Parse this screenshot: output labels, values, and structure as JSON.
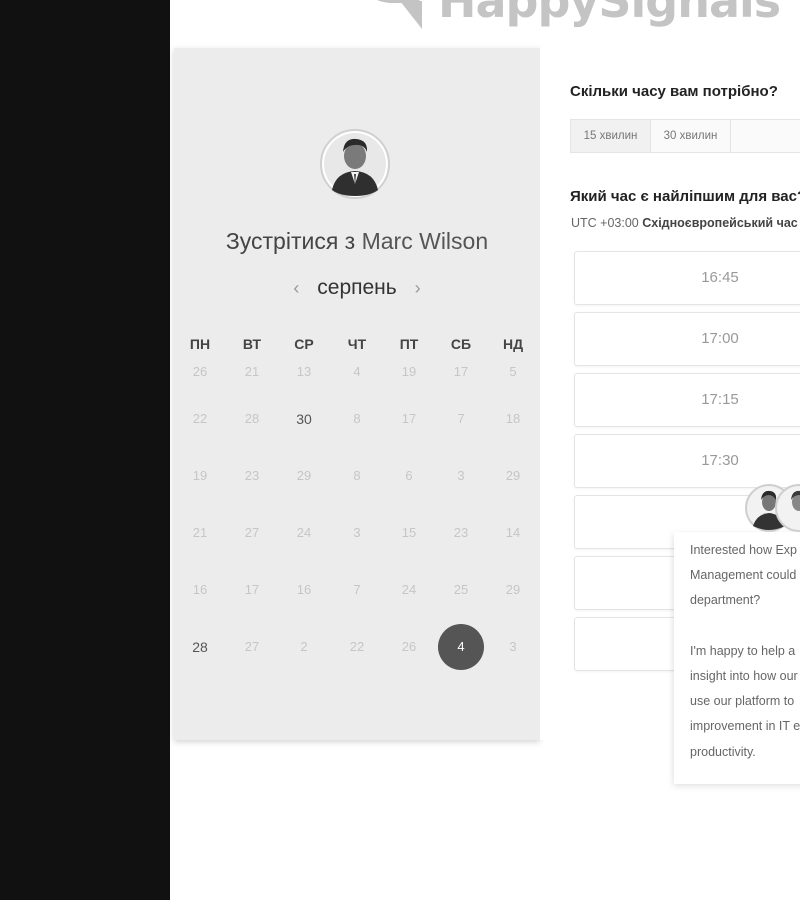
{
  "brand": {
    "name": "HappySignals"
  },
  "card": {
    "title_prefix": "Зустрітися з ",
    "host_name": "Marc Wilson",
    "month": "серпень",
    "prev_icon": "chevron-left-icon",
    "next_icon": "chevron-right-icon"
  },
  "calendar": {
    "weekdays": [
      "ПН",
      "ВТ",
      "СР",
      "ЧТ",
      "ПТ",
      "СБ",
      "НД"
    ],
    "weeks": [
      [
        "26",
        "21",
        "13",
        "4",
        "19",
        "17",
        "5"
      ],
      [
        "22",
        "28",
        "30",
        "8",
        "17",
        "7",
        "18"
      ],
      [
        "19",
        "23",
        "29",
        "8",
        "6",
        "3",
        "29"
      ],
      [
        "21",
        "27",
        "24",
        "3",
        "15",
        "23",
        "14"
      ],
      [
        "16",
        "17",
        "16",
        "7",
        "24",
        "25",
        "29"
      ],
      [
        "28",
        "27",
        "2",
        "22",
        "26",
        "4",
        "3"
      ]
    ],
    "available": [
      "1-2",
      "5-0"
    ],
    "selected": "5-5"
  },
  "duration": {
    "question": "Скільки часу вам потрібно?",
    "options": [
      "15 хвилин",
      "30 хвилин",
      ""
    ]
  },
  "time": {
    "question": "Який час є найліпшим для вас?",
    "tz_offset": "UTC +03:00",
    "tz_name": "Східноєвропейський час",
    "slots": [
      "16:45",
      "17:00",
      "17:15",
      "17:30",
      "",
      "",
      ""
    ]
  },
  "chat": {
    "lines": [
      "Interested how Exp",
      "Management could",
      "department?",
      "",
      "I'm happy to help a",
      "insight into how our",
      "use our platform to",
      "improvement in IT e",
      "productivity."
    ]
  },
  "colors": {
    "selected_day": "#555555",
    "sidebar": "#111111",
    "card_bg": "#ececec"
  }
}
